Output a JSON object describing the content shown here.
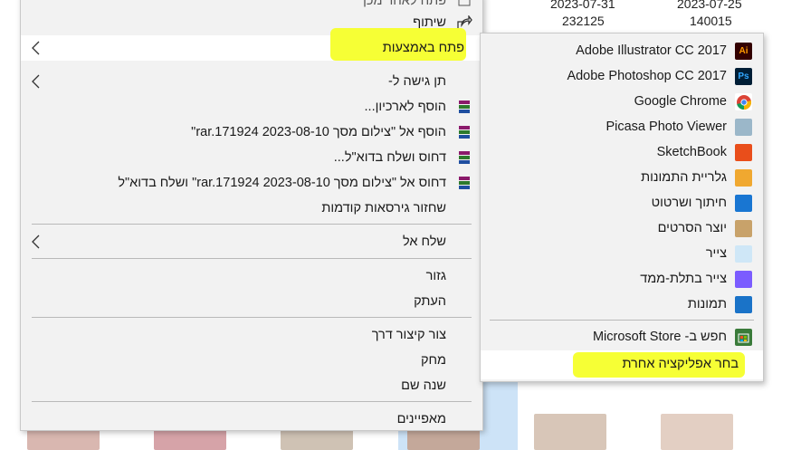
{
  "background": {
    "dates": [
      "2023-07-31",
      "2023-07-25"
    ],
    "sizes": [
      "232125",
      "140015"
    ]
  },
  "menu": {
    "top_partial_label": "פתח לאחר מכן",
    "share": "שיתוף",
    "open_with": "פתח באמצעות",
    "give_access": "תן גישה ל-",
    "add_to_archive": "הוסף לארכיון...",
    "add_to_rar": "הוסף אל \"צילום מסך 2023-08-10 rar.171924\"",
    "compress_email": "דחוס ושלח בדוא\"ל...",
    "compress_rar_email": "דחוס אל \"צילום מסך 2023-08-10 rar.171924\" ושלח בדוא\"ל",
    "restore_versions": "שחזור גירסאות קודמות",
    "send_to": "שלח אל",
    "cut": "גזור",
    "copy": "העתק",
    "create_shortcut": "צור קיצור דרך",
    "delete": "מחק",
    "rename": "שנה שם",
    "properties": "מאפיינים"
  },
  "submenu": {
    "apps": [
      {
        "label": "Adobe Illustrator CC 2017",
        "icon": "Ai",
        "icon_name": "illustrator-icon",
        "color": "#330000",
        "fg": "#ff9a00"
      },
      {
        "label": "Adobe Photoshop CC 2017",
        "icon": "Ps",
        "icon_name": "photoshop-icon",
        "color": "#001e36",
        "fg": "#31a8ff"
      },
      {
        "label": "Google Chrome",
        "icon": "",
        "icon_name": "chrome-icon",
        "color": "#ffffff",
        "fg": "#000"
      },
      {
        "label": "Picasa Photo Viewer",
        "icon": "",
        "icon_name": "picasa-icon",
        "color": "#9bb7c9",
        "fg": "#000"
      },
      {
        "label": "SketchBook",
        "icon": "",
        "icon_name": "sketchbook-icon",
        "color": "#e94e1b",
        "fg": "#fff"
      },
      {
        "label": "גלריית התמונות",
        "icon": "",
        "icon_name": "photo-gallery-icon",
        "color": "#f0a830",
        "fg": "#fff"
      },
      {
        "label": "חיתוך ושרטוט",
        "icon": "",
        "icon_name": "snip-sketch-icon",
        "color": "#1976d2",
        "fg": "#fff"
      },
      {
        "label": "יוצר הסרטים",
        "icon": "",
        "icon_name": "movie-maker-icon",
        "color": "#c8a26a",
        "fg": "#fff"
      },
      {
        "label": "צייר",
        "icon": "",
        "icon_name": "paint-icon",
        "color": "#cfe7f7",
        "fg": "#000"
      },
      {
        "label": "צייר בתלת-ממד",
        "icon": "",
        "icon_name": "paint-3d-icon",
        "color": "#7b5cff",
        "fg": "#fff"
      },
      {
        "label": "תמונות",
        "icon": "",
        "icon_name": "photos-icon",
        "color": "#1a73c8",
        "fg": "#fff"
      }
    ],
    "store": "חפש ב- Microsoft Store",
    "choose_other": "בחר אפליקציה אחרת"
  },
  "colors": {
    "highlight_marker": "#f5ff2a",
    "menu_bg": "#f2f2f2"
  }
}
